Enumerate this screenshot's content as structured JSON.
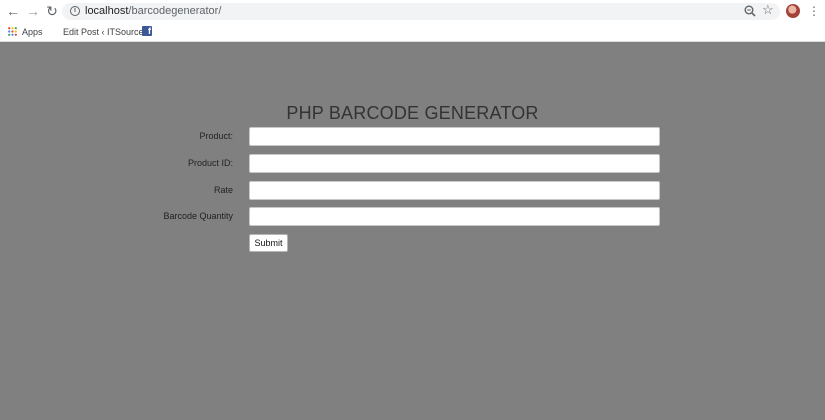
{
  "browser": {
    "url_host": "localhost",
    "url_path": "/barcodegenerator/",
    "bookmarks": [
      {
        "label": "Apps",
        "icon": "apps-grid-icon"
      },
      {
        "label": "Edit Post ‹ ITSource...",
        "icon": "none"
      },
      {
        "label": "",
        "icon": "facebook-icon"
      }
    ]
  },
  "page": {
    "title": "PHP BARCODE GENERATOR",
    "fields": [
      {
        "label": "Product:",
        "value": "",
        "placeholder": ""
      },
      {
        "label": "Product ID:",
        "value": "",
        "placeholder": ""
      },
      {
        "label": "Rate",
        "value": "",
        "placeholder": ""
      },
      {
        "label": "Barcode Quantity",
        "value": "",
        "placeholder": ""
      }
    ],
    "submit_label": "Submit"
  },
  "colors": {
    "page_background": "#808080",
    "input_background": "#ffffff",
    "facebook": "#3b5998"
  }
}
